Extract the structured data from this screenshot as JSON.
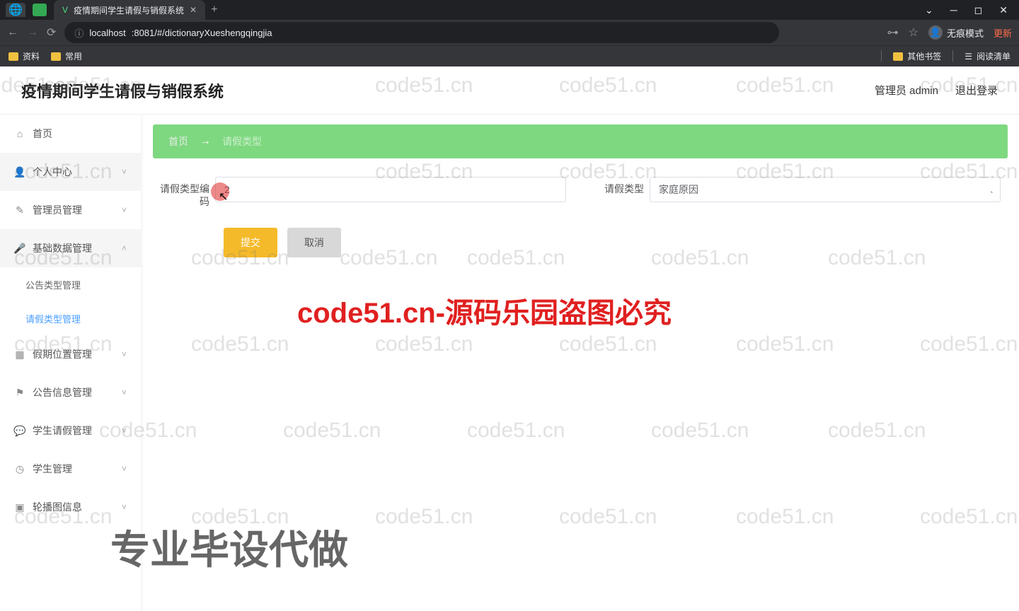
{
  "browser": {
    "tab_title": "疫情期间学生请假与销假系统",
    "url_host": "localhost",
    "url_rest": ":8081/#/dictionaryXueshengqingjia",
    "incognito": "无痕模式",
    "update": "更新",
    "bookmarks": {
      "b1": "资料",
      "b2": "常用",
      "other": "其他书签",
      "readlist": "阅读清单"
    }
  },
  "header": {
    "title": "疫情期间学生请假与销假系统",
    "user": "管理员 admin",
    "logout": "退出登录"
  },
  "sidebar": {
    "home": "首页",
    "personal": "个人中心",
    "admin": "管理员管理",
    "basedata": "基础数据管理",
    "sub_notice_type": "公告类型管理",
    "sub_leave_type": "请假类型管理",
    "vacation_loc": "假期位置管理",
    "notice_info": "公告信息管理",
    "student_leave": "学生请假管理",
    "student_mgmt": "学生管理",
    "carousel": "轮播图信息"
  },
  "breadcrumb": {
    "home": "首页",
    "current": "请假类型"
  },
  "form": {
    "code_label": "请假类型编码",
    "code_value": "2",
    "type_label": "请假类型",
    "type_value": "家庭原因",
    "submit": "提交",
    "cancel": "取消"
  },
  "watermark": {
    "text": "code51.cn",
    "red": "code51.cn-源码乐园盗图必究",
    "big": "专业毕设代做"
  }
}
